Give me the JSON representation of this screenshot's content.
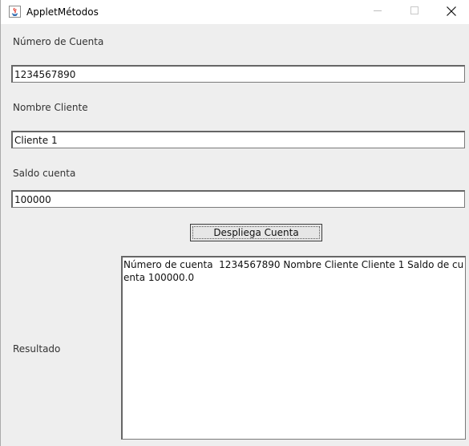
{
  "window": {
    "title": "AppletMétodos",
    "icon": "java-icon"
  },
  "controls": {
    "minimize_icon": "minimize-icon",
    "maximize_icon": "maximize-icon",
    "close_icon": "close-icon"
  },
  "form": {
    "account_number_label": "Número de Cuenta",
    "account_number_value": "1234567890",
    "client_name_label": "Nombre Cliente",
    "client_name_value": "Cliente 1",
    "balance_label": "Saldo cuenta",
    "balance_value": "100000",
    "display_button_label": "Despliega Cuenta",
    "result_label": "Resultado",
    "result_text": "Número de cuenta  1234567890 Nombre Cliente Cliente 1 Saldo de cuenta 100000.0"
  }
}
